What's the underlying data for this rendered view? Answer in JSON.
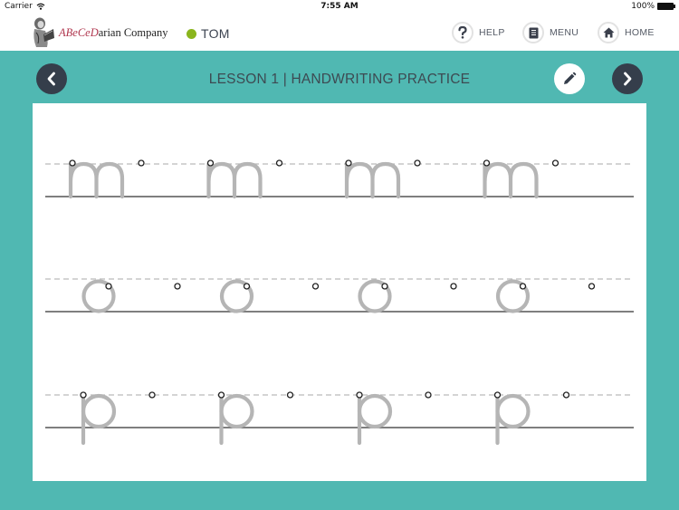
{
  "status_bar": {
    "carrier": "Carrier",
    "wifi_icon": "wifi-icon",
    "time": "7:55 AM",
    "battery_percent": "100%",
    "battery_icon": "battery-icon"
  },
  "header": {
    "logo": {
      "accent_text": "ABeCeD",
      "rest_text": "arian Company",
      "figure_icon": "reading-figure-icon"
    },
    "user": {
      "name": "TOM",
      "status_color": "#8ab51d"
    },
    "buttons": [
      {
        "label": "HELP",
        "icon": "question-icon"
      },
      {
        "label": "MENU",
        "icon": "notebook-icon"
      },
      {
        "label": "HOME",
        "icon": "home-icon"
      }
    ]
  },
  "toolbar": {
    "title": "LESSON 1 | HANDWRITING PRACTICE",
    "prev_icon": "chevron-left-icon",
    "edit_icon": "pencil-icon",
    "next_icon": "chevron-right-icon"
  },
  "practice": {
    "rows": [
      {
        "letter": "m",
        "repetitions": 4
      },
      {
        "letter": "o",
        "repetitions": 4
      },
      {
        "letter": "p",
        "repetitions": 4
      }
    ]
  },
  "colors": {
    "teal_background": "#50b8b2",
    "nav_dark": "#353e4b",
    "letter_guide": "#b5b5b5",
    "baseline": "#555555",
    "midline": "#bbbbbb"
  }
}
